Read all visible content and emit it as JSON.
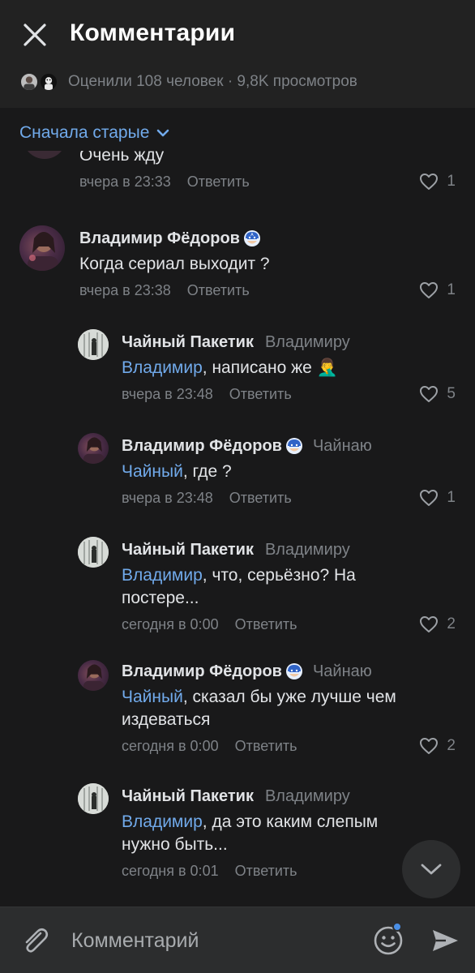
{
  "header": {
    "title": "Комментарии",
    "stats": "Оценили 108 человек · 9,8K просмотров"
  },
  "sort": {
    "label": "Сначала старые"
  },
  "partial_comment": {
    "text": "Очень жду",
    "time": "вчера в 23:33",
    "reply_label": "Ответить",
    "likes": "1"
  },
  "comments": [
    {
      "author": "Владимир Фёдоров",
      "reply_to": "",
      "mention": "",
      "text": "Когда сериал выходит ?",
      "time": "вчера в 23:38",
      "reply_label": "Ответить",
      "likes": "1"
    },
    {
      "author": "Чайный Пакетик",
      "reply_to": "Владимиру",
      "mention": "Владимир",
      "text": ", написано же 🤦‍♂️",
      "time": "вчера в 23:48",
      "reply_label": "Ответить",
      "likes": "5"
    },
    {
      "author": "Владимир Фёдоров",
      "reply_to": "Чайнаю",
      "mention": "Чайный",
      "text": ", где ?",
      "time": "вчера в 23:48",
      "reply_label": "Ответить",
      "likes": "1"
    },
    {
      "author": "Чайный Пакетик",
      "reply_to": "Владимиру",
      "mention": "Владимир",
      "text": ", что, серьёзно? На постере...",
      "time": "сегодня в 0:00",
      "reply_label": "Ответить",
      "likes": "2"
    },
    {
      "author": "Владимир Фёдоров",
      "reply_to": "Чайнаю",
      "mention": "Чайный",
      "text": ", сказал бы уже лучше чем издеваться",
      "time": "сегодня в 0:00",
      "reply_label": "Ответить",
      "likes": "2"
    },
    {
      "author": "Чайный Пакетик",
      "reply_to": "Владимиру",
      "mention": "Владимир",
      "text": ", да это каким слепым нужно быть...",
      "time": "сегодня в 0:01",
      "reply_label": "Ответить",
      "likes": ""
    }
  ],
  "composer": {
    "placeholder": "Комментарий"
  },
  "colors": {
    "background": "#19191a",
    "header": "#222222",
    "accent": "#71aaeb",
    "secondary_text": "#7e8287",
    "composer": "#2c2d2e"
  },
  "icons": [
    "close-icon",
    "chevron-down-icon",
    "heart-icon",
    "captain-america-badge-icon",
    "arrow-down-icon",
    "paperclip-icon",
    "smile-icon",
    "send-icon"
  ]
}
